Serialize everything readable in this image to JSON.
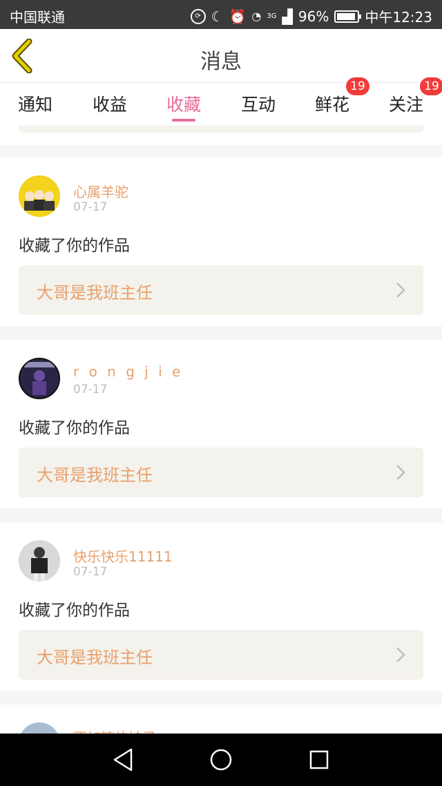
{
  "status": {
    "carrier": "中国联通",
    "battery": "96%",
    "time": "中午12:23",
    "network": "3G"
  },
  "header": {
    "title": "消息"
  },
  "tabs": [
    {
      "label": "通知"
    },
    {
      "label": "收益"
    },
    {
      "label": "收藏",
      "active": true
    },
    {
      "label": "互动"
    },
    {
      "label": "鲜花",
      "badge": "19"
    },
    {
      "label": "关注",
      "badge": "19"
    }
  ],
  "items": [
    {
      "username": "心属羊驼",
      "date": "07-17",
      "action": "收藏了你的作品",
      "work_title": "大哥是我班主任"
    },
    {
      "username": "r o n g  j i e",
      "date": "07-17",
      "action": "收藏了你的作品",
      "work_title": "大哥是我班主任"
    },
    {
      "username": "快乐快乐11111",
      "date": "07-17",
      "action": "收藏了你的作品",
      "work_title": "大哥是我班主任"
    },
    {
      "username": "不加糖的妹子",
      "date": "",
      "action": "",
      "work_title": ""
    }
  ],
  "colors": {
    "accent": "#e86b9b",
    "username": "#e8a06c",
    "badge": "#f23b3b",
    "back_icon": "#c9b800"
  },
  "icons": [
    "back-arrow-icon",
    "chevron-right-icon",
    "nav-back-icon",
    "nav-home-icon",
    "nav-recents-icon"
  ]
}
